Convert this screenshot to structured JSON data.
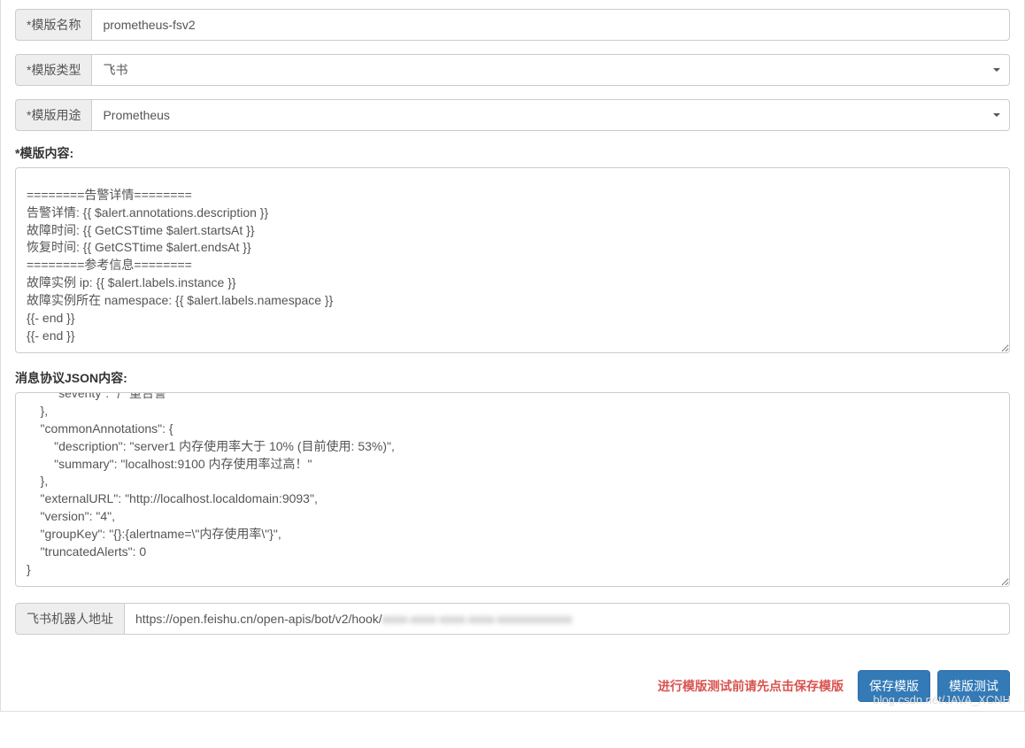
{
  "fields": {
    "name_label": "*模版名称",
    "name_value": "prometheus-fsv2",
    "type_label": "*模版类型",
    "type_value": "飞书",
    "usage_label": "*模版用途",
    "usage_value": "Prometheus",
    "content_label": "*模版内容:",
    "content_value": "{{- end }}\n\n========告警详情========\n告警详情: {{ $alert.annotations.description }}\n故障时间: {{ GetCSTtime $alert.startsAt }}\n恢复时间: {{ GetCSTtime $alert.endsAt }}\n========参考信息========\n故障实例 ip: {{ $alert.labels.instance }}\n故障实例所在 namespace: {{ $alert.labels.namespace }}\n{{- end }}\n{{- end }}",
    "json_label": "消息协议JSON内容:",
    "json_value": "        \"severity\": \"严重告警\"\n    },\n    \"commonAnnotations\": {\n        \"description\": \"server1 内存使用率大于 10% (目前使用: 53%)\",\n        \"summary\": \"localhost:9100 内存使用率过高！\"\n    },\n    \"externalURL\": \"http://localhost.localdomain:9093\",\n    \"version\": \"4\",\n    \"groupKey\": \"{}:{alertname=\\\"内存使用率\\\"}\",\n    \"truncatedAlerts\": 0\n}",
    "bot_label": "飞书机器人地址",
    "bot_value_prefix": "https://open.feishu.cn/open-apis/bot/v2/hook/",
    "bot_value_blurred": "xxxx-xxxx-xxxx-xxxx-xxxxxxxxxxxx"
  },
  "footer": {
    "hint": "进行模版测试前请先点击保存模版",
    "save_label": "保存模版",
    "test_label": "模版测试"
  },
  "watermark": "blog.csdn.net/JAVA_XCNH"
}
